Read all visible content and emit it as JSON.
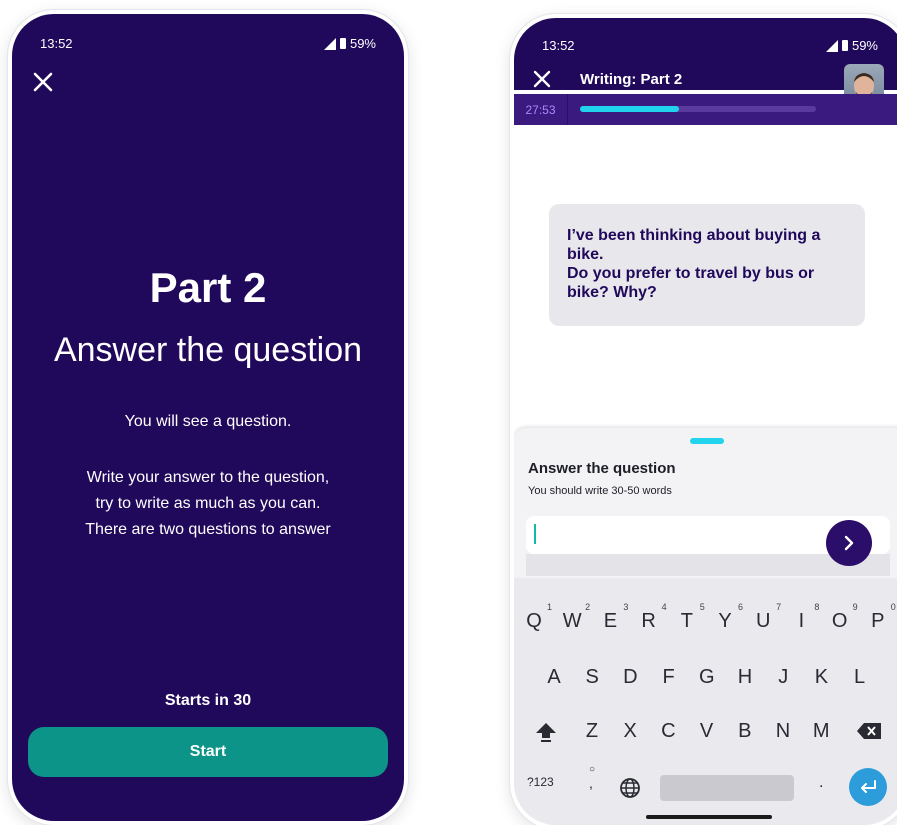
{
  "left_screen": {
    "status": {
      "time": "13:52",
      "battery": "59%"
    },
    "title": "Part 2",
    "subtitle": "Answer the question",
    "intro": "You will see a question.",
    "instructions": [
      "Write your answer to the question,",
      "try to write as much as you can.",
      "There are two questions to answer"
    ],
    "countdown": "Starts in 30",
    "start_label": "Start",
    "colors": {
      "background": "#20085a",
      "start_button": "#0d9488"
    }
  },
  "right_screen": {
    "status": {
      "time": "13:52",
      "battery": "59%"
    },
    "header_title": "Writing: Part 2",
    "timer": "27:53",
    "progress": 0.42,
    "question": "I’ve been thinking about buying a bike.\nDo you prefer to travel by bus or bike? Why?",
    "question_lines": [
      "I’ve been thinking about buying a",
      "bike.",
      "Do you prefer to travel by bus or",
      "bike? Why?"
    ],
    "sheet_title": "Answer the question",
    "sheet_hint": "You should write 30-50 words",
    "input_value": "",
    "colors": {
      "header": "#20085a",
      "accent": "#22d3ee",
      "send_button": "#2b0d6a"
    }
  },
  "keyboard": {
    "row1": [
      {
        "key": "Q",
        "num": "1"
      },
      {
        "key": "W",
        "num": "2"
      },
      {
        "key": "E",
        "num": "3"
      },
      {
        "key": "R",
        "num": "4"
      },
      {
        "key": "T",
        "num": "5"
      },
      {
        "key": "Y",
        "num": "6"
      },
      {
        "key": "U",
        "num": "7"
      },
      {
        "key": "I",
        "num": "8"
      },
      {
        "key": "O",
        "num": "9"
      },
      {
        "key": "P",
        "num": "0"
      }
    ],
    "row2": [
      "A",
      "S",
      "D",
      "F",
      "G",
      "H",
      "J",
      "K",
      "L"
    ],
    "row3": [
      "Z",
      "X",
      "C",
      "V",
      "B",
      "N",
      "M"
    ],
    "symbols_label": "?123",
    "comma_label": ",",
    "period_label": "."
  }
}
